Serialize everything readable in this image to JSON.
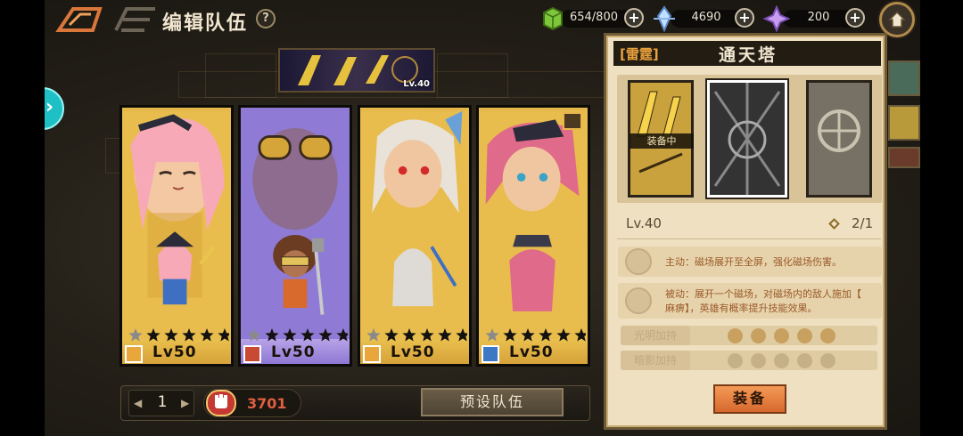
{
  "header": {
    "title": "编辑队伍",
    "help_symbol": "?",
    "stamina": "654/800",
    "crystals": "4690",
    "gems": "200",
    "plus": "+"
  },
  "weapon_tab": {
    "level": "Lv.40"
  },
  "heroes": [
    {
      "level": "Lv50",
      "stars": 5,
      "bg": "#e6b849",
      "class_color": "#e9a63b"
    },
    {
      "level": "Lv50",
      "stars": 5,
      "bg": "#8e78d4",
      "class_color": "#c84a32"
    },
    {
      "level": "Lv50",
      "stars": 5,
      "bg": "#e6b849",
      "class_color": "#e9a63b"
    },
    {
      "level": "Lv50",
      "stars": 5,
      "bg": "#e6b849",
      "class_color": "#3d78c4"
    }
  ],
  "bottom": {
    "page": "1",
    "power": "3701",
    "preset_label": "预设队伍",
    "prev": "◀",
    "next": "▶"
  },
  "panel": {
    "tag": "[雷霆]",
    "name": "通天塔",
    "equipped_label": "装备中",
    "level": "Lv.40",
    "count": "2/1",
    "active_skill": "主动：磁场展开至全屏，强化磁场伤害。",
    "passive_skill_line1": "被动：展开一个磁场，对磁场内的敌人施加【",
    "passive_skill_line2": "麻痹】，英雄有概率提升技能效果。",
    "light_blessing": "光明加持",
    "dark_blessing": "暗影加持",
    "equip_button": "装备"
  }
}
